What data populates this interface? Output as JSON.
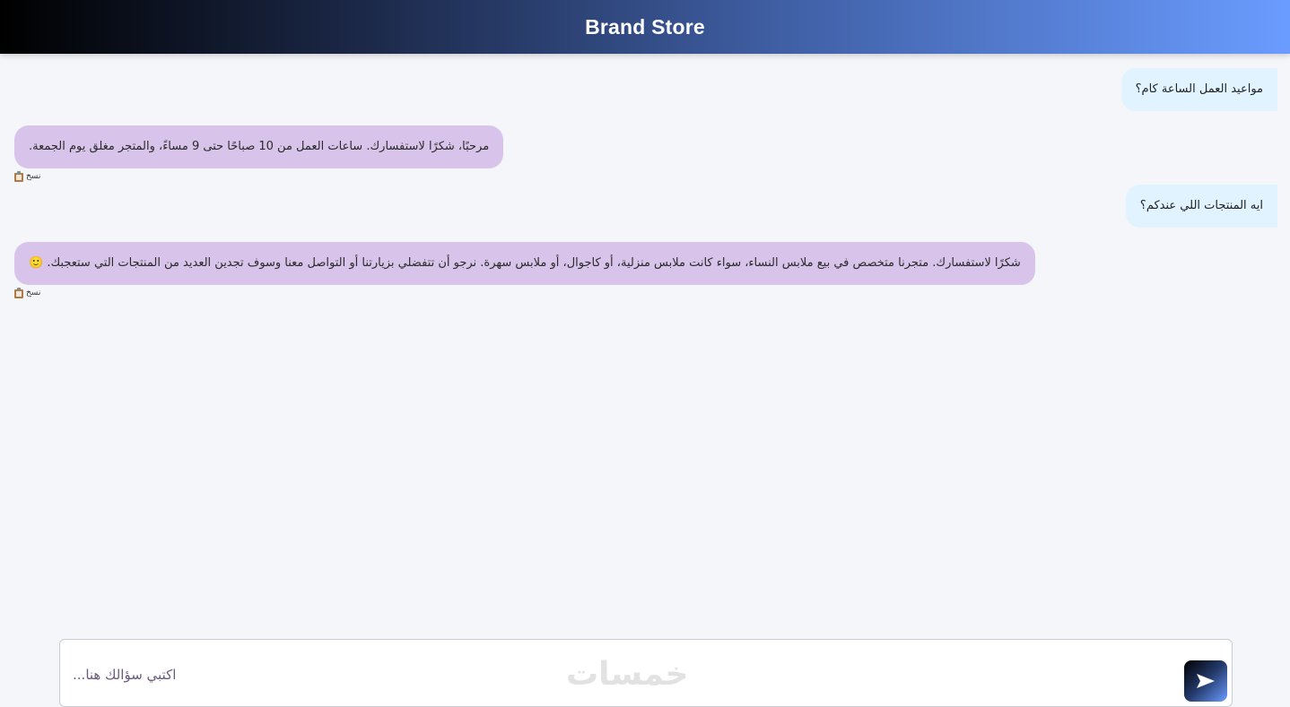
{
  "header": {
    "title": "Brand Store"
  },
  "messages": [
    {
      "role": "user",
      "text": "مواعيد العمل الساعة كام؟"
    },
    {
      "role": "bot",
      "text": "مرحبًا، شكرًا لاستفسارك. ساعات العمل من 10 صباحًا حتى 9 مساءً، والمتجر مغلق يوم الجمعة.",
      "copy_label": "نسخ"
    },
    {
      "role": "user",
      "text": "ايه المنتجات اللي عندكم؟"
    },
    {
      "role": "bot",
      "text": "شكرًا لاستفسارك. متجرنا متخصص في بيع ملابس النساء، سواء كانت ملابس منزلية، أو كاجوال، أو ملابس سهرة. نرجو أن تتفضلي بزيارتنا أو التواصل معنا وسوف تجدين العديد من المنتجات التي ستعجبك. 🙂",
      "copy_label": "نسخ"
    }
  ],
  "input": {
    "placeholder": "...اكتبي سؤالك هنا",
    "value": ""
  },
  "watermark": {
    "text": "خمسات"
  },
  "icons": {
    "copy": "clipboard-icon",
    "send": "send-arrow-icon"
  },
  "colors": {
    "user_bubble": "#e0f3ff",
    "bot_bubble": "#d8c4ea",
    "background": "#f4f6fa",
    "header_gradient_start": "#000000",
    "header_gradient_end": "#6a9cff"
  }
}
